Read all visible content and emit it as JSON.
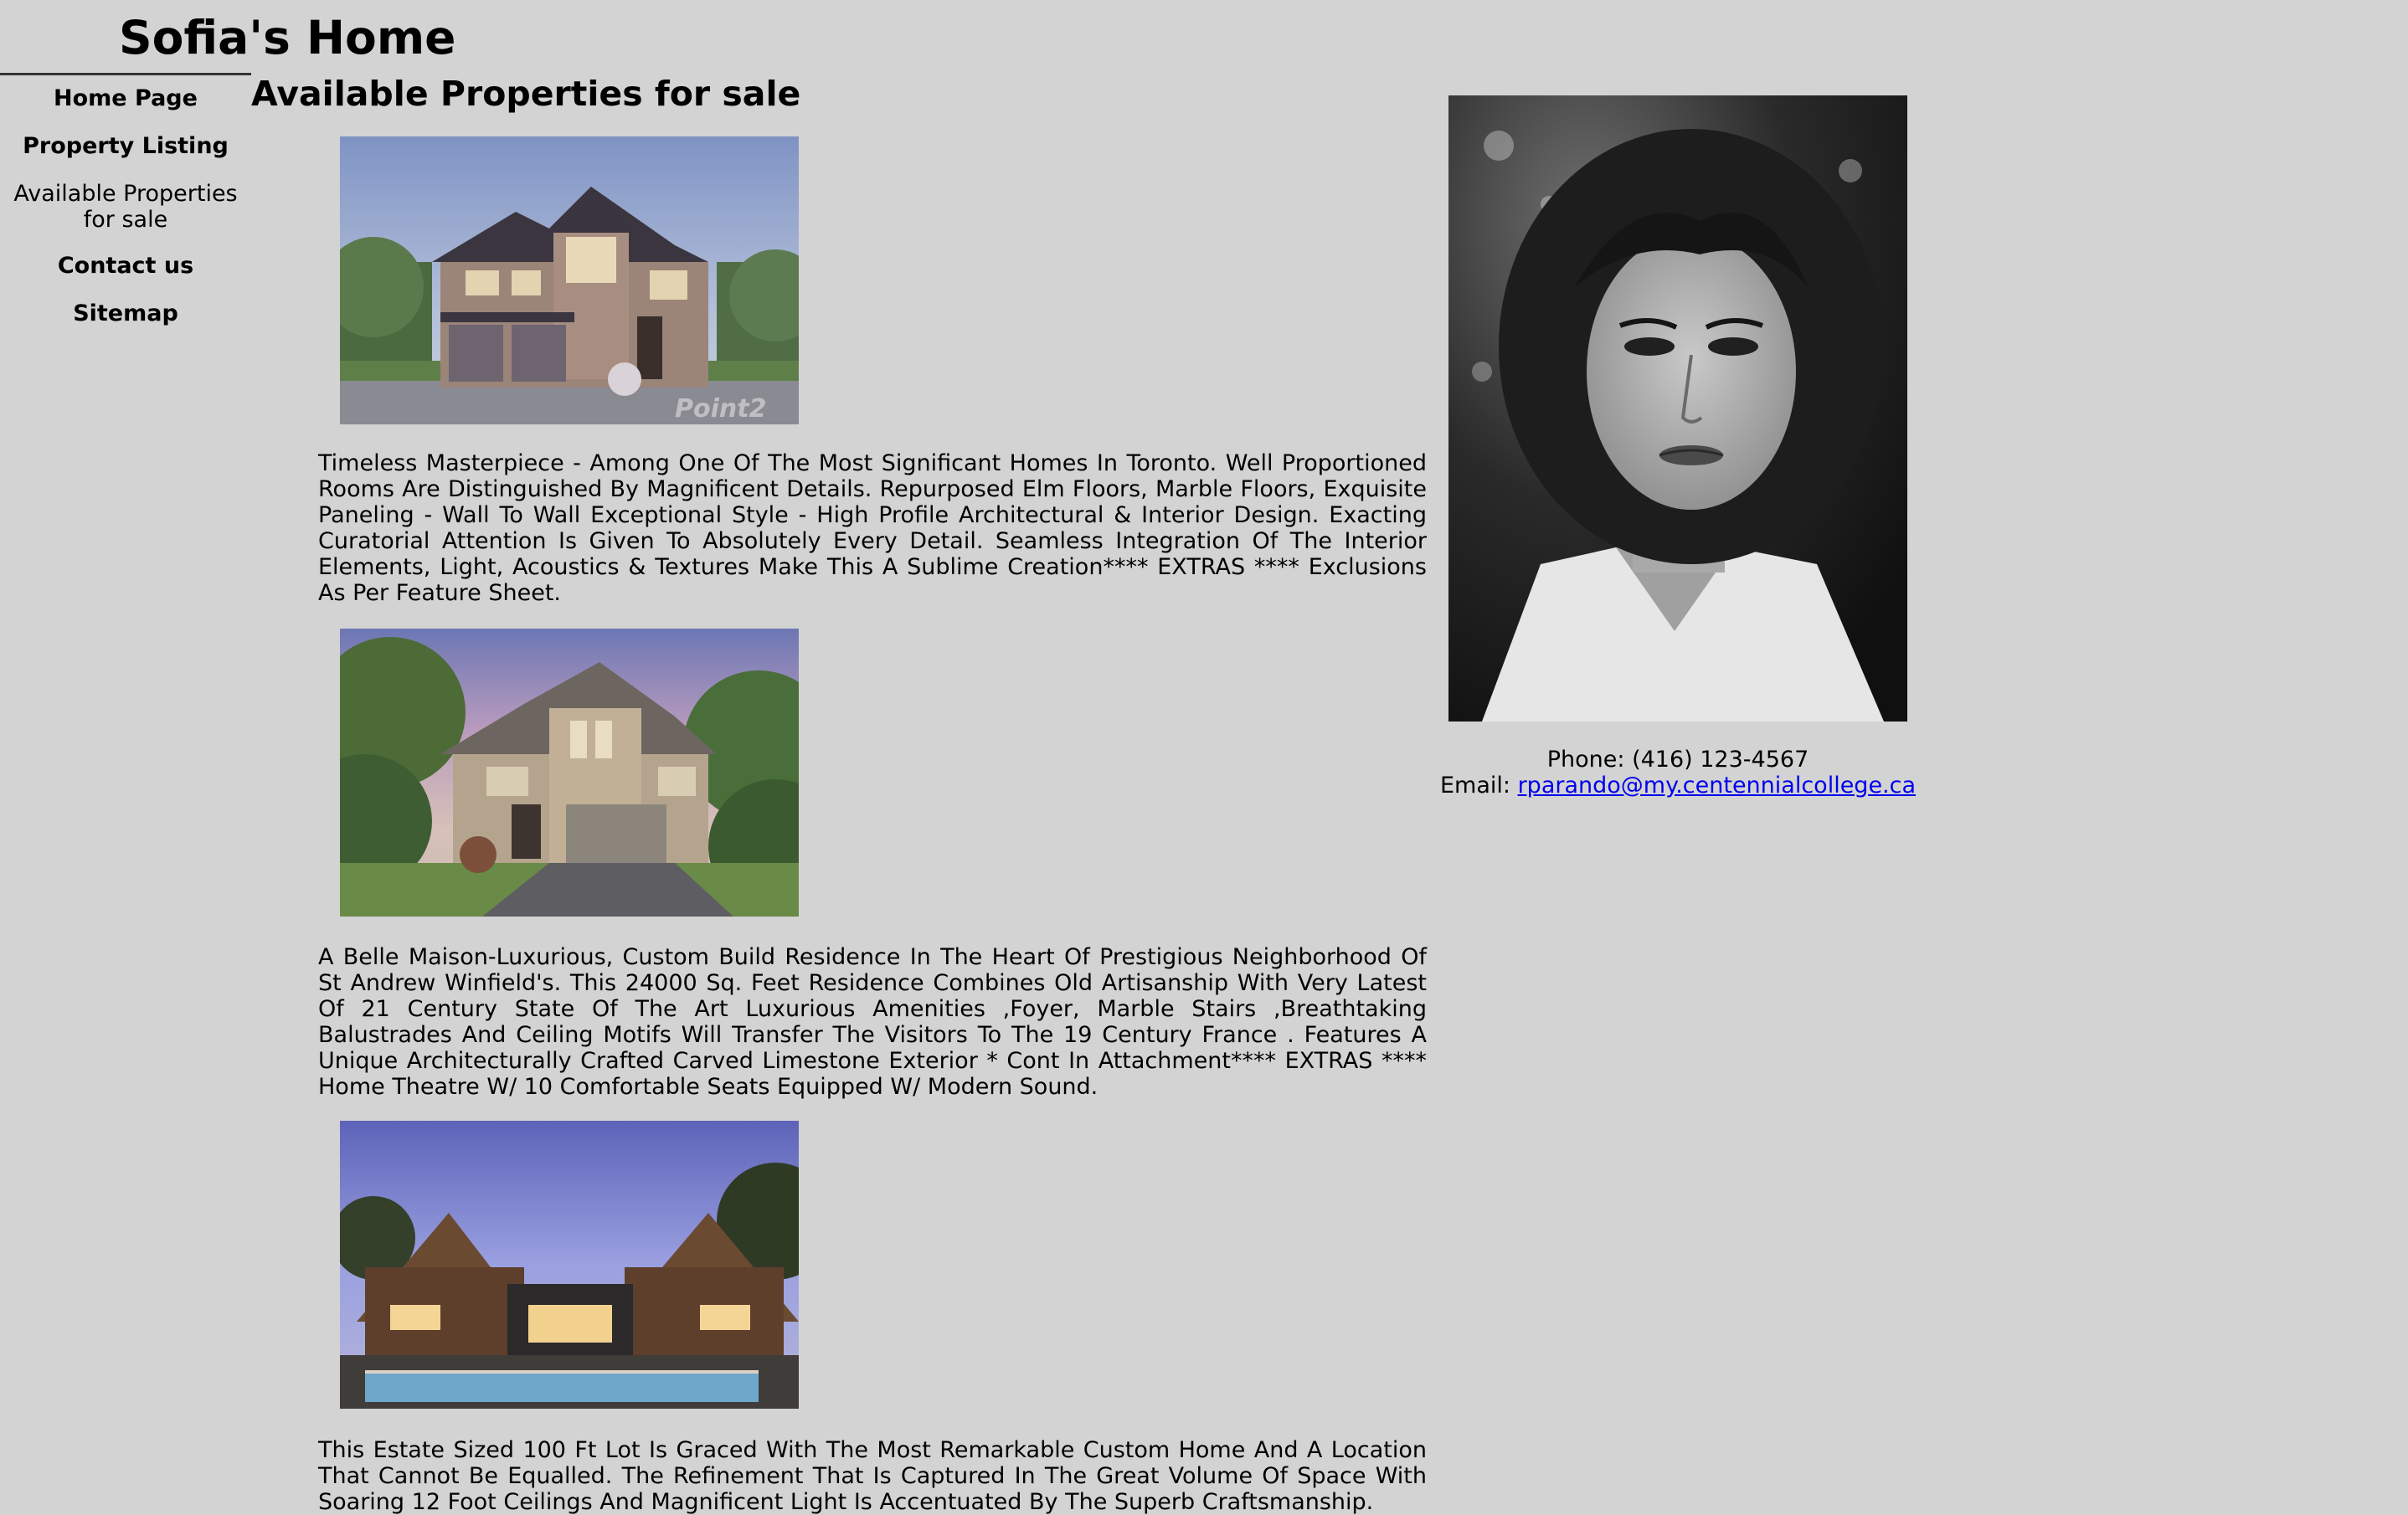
{
  "site": {
    "title": "Sofia's Home"
  },
  "nav": {
    "items": [
      {
        "label": "Home Page",
        "bold": true
      },
      {
        "label": "Property Listing",
        "bold": true
      },
      {
        "label": "Available Properties for sale",
        "bold": false
      },
      {
        "label": "Contact us",
        "bold": true
      },
      {
        "label": "Sitemap",
        "bold": true
      }
    ]
  },
  "main": {
    "heading": "Available Properties for sale",
    "listings": [
      {
        "image": "two-storey stone house with double garage",
        "description": "Timeless Masterpiece - Among One Of The Most Significant Homes In Toronto. Well Proportioned Rooms Are Distinguished By Magnificent Details. Repurposed Elm Floors, Marble Floors, Exquisite Paneling - Wall To Wall Exceptional Style - High Profile Architectural & Interior Design. Exacting Curatorial Attention Is Given To Absolutely Every Detail. Seamless Integration Of The Interior Elements, Light, Acoustics & Textures Make This A Sublime Creation**** EXTRAS **** Exclusions As Per Feature Sheet.",
        "watermark": "Point2"
      },
      {
        "image": "stone house with double garage among trees",
        "description": "A Belle Maison-Luxurious, Custom Build Residence In The Heart Of Prestigious Neighborhood Of St Andrew Winfield's. This 24000 Sq. Feet Residence Combines Old Artisanship With Very Latest Of 21 Century State Of The Art Luxurious Amenities ,Foyer, Marble Stairs ,Breathtaking Balustrades And Ceiling Motifs Will Transfer The Visitors To The 19 Century France . Features A Unique Architecturally Crafted Carved Limestone Exterior * Cont In Attachment**** EXTRAS **** Home Theatre W/ 10 Comfortable Seats Equipped W/ Modern Sound."
      },
      {
        "image": "modern wooden house with pool at dusk",
        "description": "This Estate Sized 100 Ft Lot Is Graced With The Most Remarkable Custom Home And A Location That Cannot Be Equalled. The Refinement That Is Captured In The Great Volume Of Space With Soaring 12 Foot Ceilings And Magnificent Light Is Accentuated By The Superb Craftsmanship."
      }
    ]
  },
  "agent": {
    "photo": "black-and-white portrait",
    "phone_label": "Phone: (416) 123-4567",
    "email_prefix": "Email:",
    "email": "rparando@my.centennialcollege.ca"
  },
  "colors": {
    "background": "#d3d3d3",
    "link": "#0000ee",
    "text": "#000000"
  }
}
